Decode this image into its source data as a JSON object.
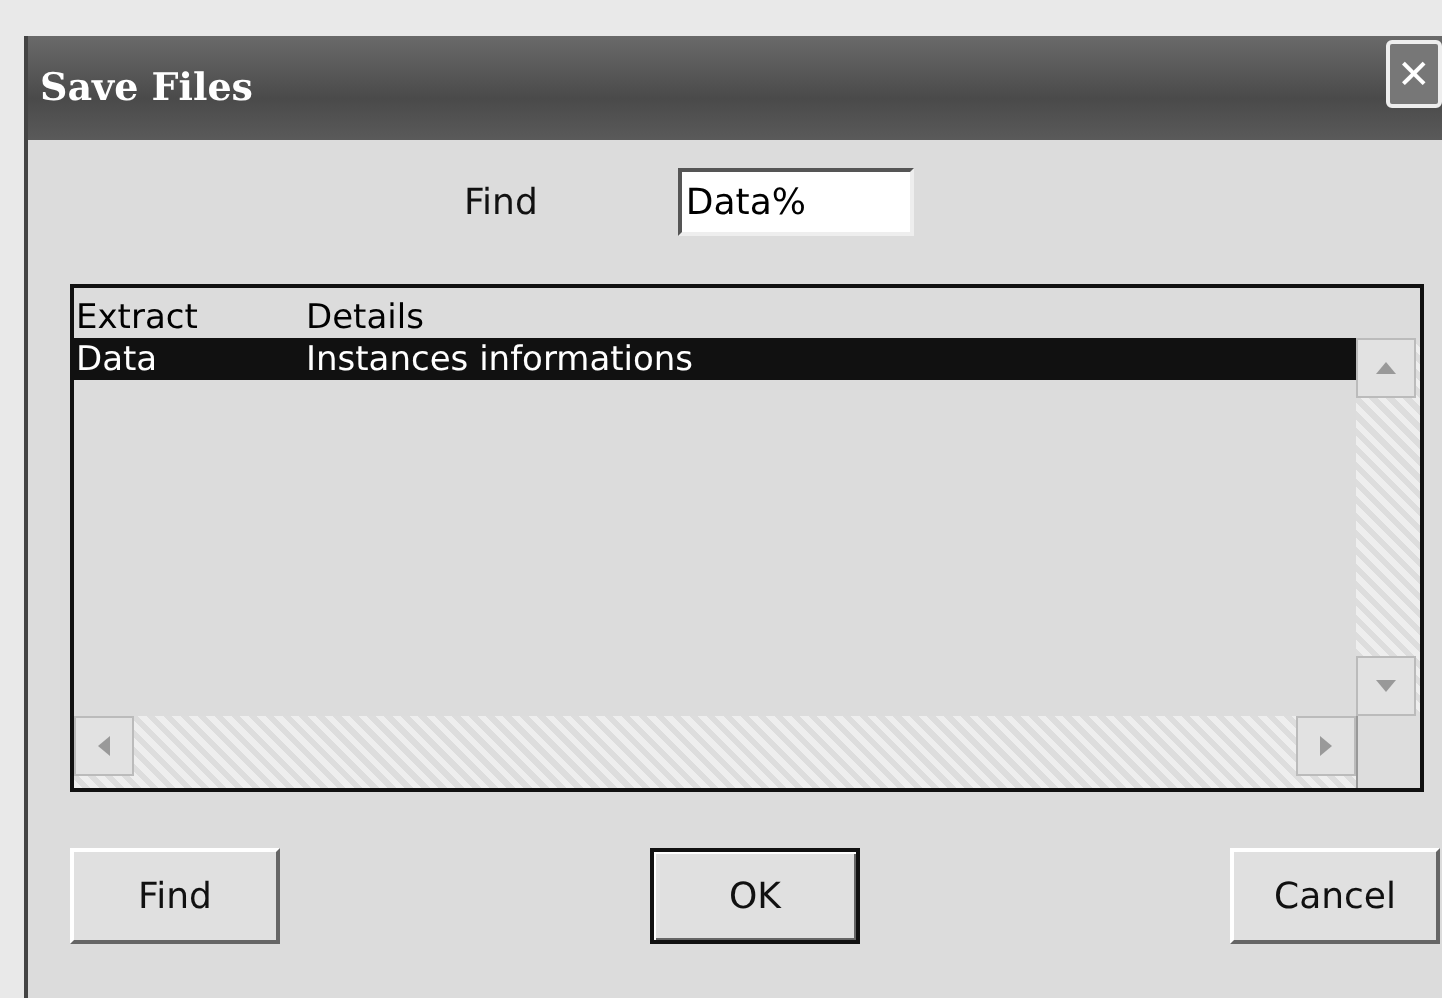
{
  "window": {
    "title": "Save Files",
    "close": "✕"
  },
  "find": {
    "label": "Find",
    "value": "Data%"
  },
  "table": {
    "columns": [
      "Extract",
      "Details"
    ],
    "rows": [
      {
        "cells": [
          "Data",
          "Instances informations"
        ],
        "selected": true
      }
    ]
  },
  "buttons": [
    {
      "label": "Find",
      "default": false
    },
    {
      "label": "OK",
      "default": true
    },
    {
      "label": "Cancel",
      "default": false
    }
  ]
}
